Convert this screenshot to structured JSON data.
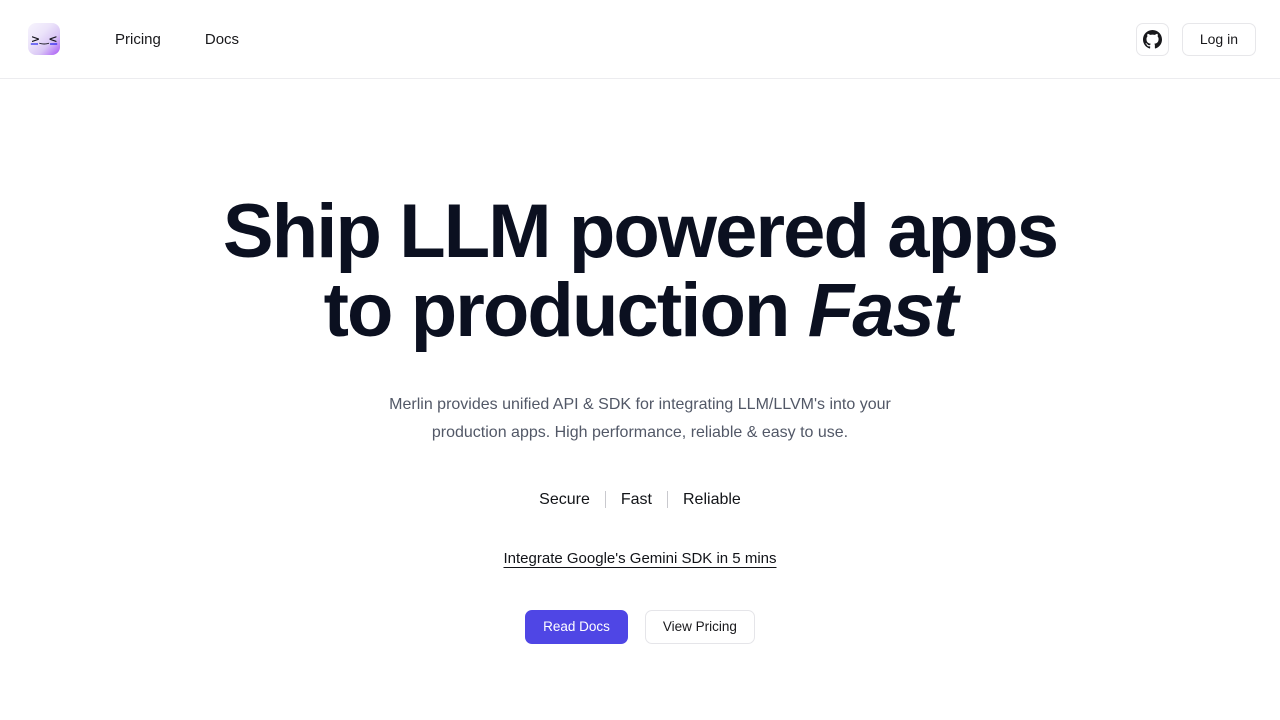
{
  "header": {
    "logo": {
      "icon_name": "merlin-kaomoji-logo",
      "glyph": ">‿<",
      "gradient_from": "#f7f4fd",
      "gradient_to": "#a855f7"
    },
    "nav": [
      {
        "label": "Pricing",
        "name": "nav-link-pricing"
      },
      {
        "label": "Docs",
        "name": "nav-link-docs"
      }
    ],
    "github": {
      "icon_name": "github-icon",
      "color": "#18181b"
    },
    "login_label": "Log in"
  },
  "hero": {
    "title_line1": "Ship LLM powered apps",
    "title_line2_prefix": "to production ",
    "title_emphasis": "Fast",
    "subtitle": "Merlin provides unified API & SDK for integrating LLM/LLVM's into your production apps. High performance, reliable & easy to use.",
    "features": [
      "Secure",
      "Fast",
      "Reliable"
    ],
    "feature_divider": "|",
    "promo_link": "Integrate Google's Gemini SDK in 5 mins",
    "cta": {
      "primary_label": "Read Docs",
      "secondary_label": "View Pricing",
      "primary_color": "#4f46e5"
    }
  }
}
